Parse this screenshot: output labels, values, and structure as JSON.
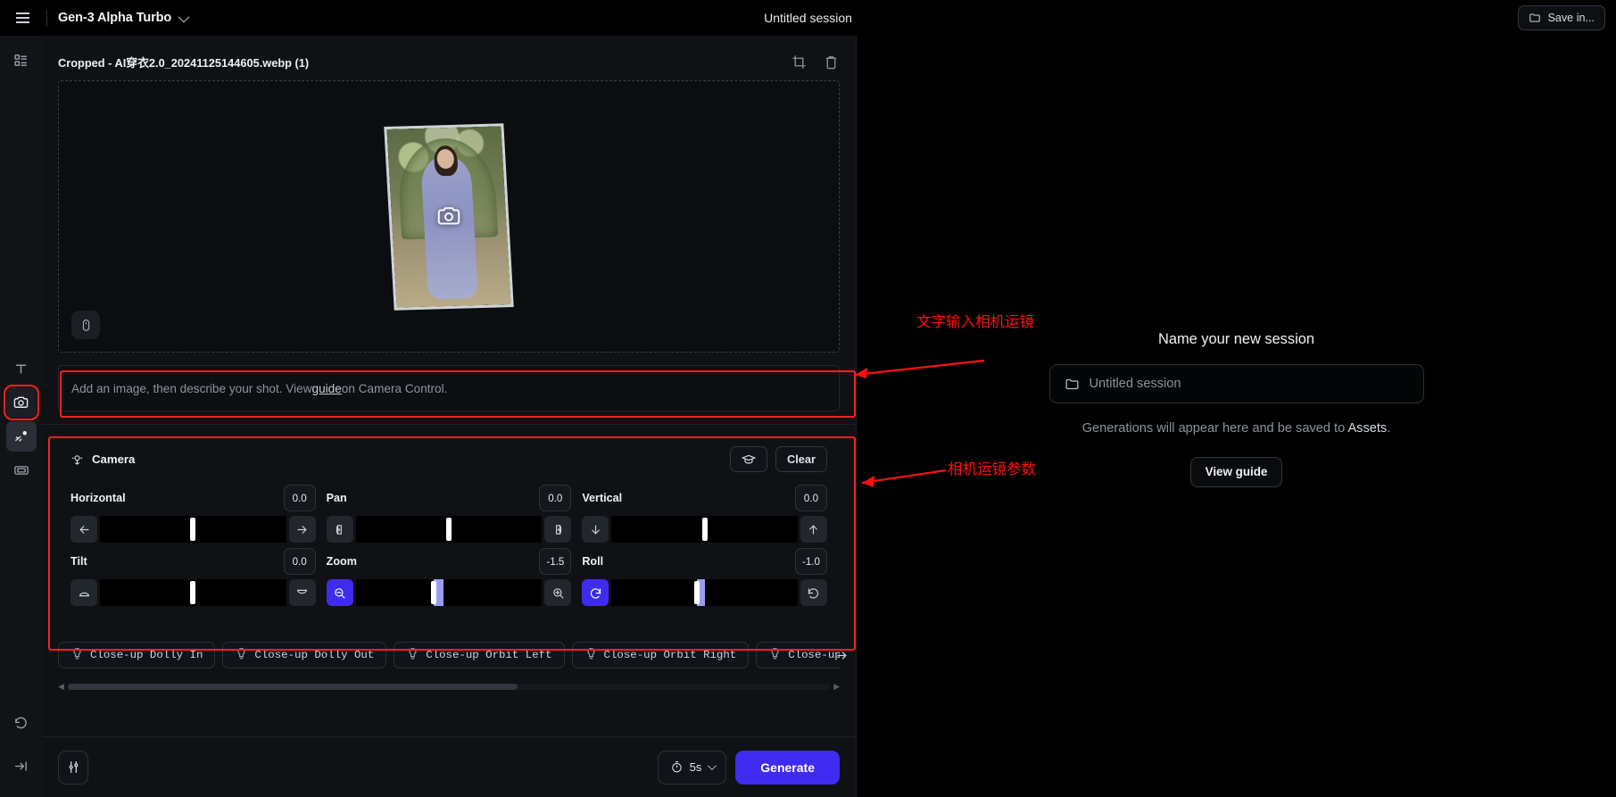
{
  "topbar": {
    "menu_icon": "hamburger-icon",
    "model": "Gen-3 Alpha Turbo",
    "session_title": "Untitled session",
    "save_in_label": "Save in...",
    "save_in_icon": "folder-icon"
  },
  "rail": {
    "items": [
      {
        "name": "assets-icon",
        "label": "Assets"
      },
      {
        "name": "text-icon",
        "label": "Text"
      },
      {
        "name": "camera-icon",
        "label": "Camera Control"
      },
      {
        "name": "motion-brush-icon",
        "label": "Motion Brush"
      },
      {
        "name": "frames-icon",
        "label": "Frames"
      },
      {
        "name": "history-icon",
        "label": "History"
      },
      {
        "name": "collapse-icon",
        "label": "Collapse"
      }
    ]
  },
  "image_panel": {
    "title": "Cropped - AI穿衣2.0_20241125144605.webp (1)",
    "crop_icon": "crop-icon",
    "delete_icon": "trash-icon",
    "overlay_icon": "camera-icon",
    "mouse_chip_icon": "mouse-icon"
  },
  "prompt": {
    "text_before": "Add an image, then describe your shot. View ",
    "link": "guide",
    "text_after": " on Camera Control."
  },
  "camera_panel": {
    "title": "Camera",
    "title_icon": "camera-move-icon",
    "guide_btn_icon": "graduation-cap-icon",
    "clear_label": "Clear",
    "controls": [
      {
        "label": "Horizontal",
        "value": "0.0",
        "left_icon": "arrow-left-icon",
        "right_icon": "arrow-right-icon",
        "thumb_pct": 50,
        "fill_pct": 0,
        "left_active": false,
        "right_active": false
      },
      {
        "label": "Pan",
        "value": "0.0",
        "left_icon": "pan-left-icon",
        "right_icon": "pan-right-icon",
        "thumb_pct": 50,
        "fill_pct": 0,
        "left_active": false,
        "right_active": false
      },
      {
        "label": "Vertical",
        "value": "0.0",
        "left_icon": "arrow-down-icon",
        "right_icon": "arrow-up-icon",
        "thumb_pct": 50,
        "fill_pct": 0,
        "left_active": false,
        "right_active": false
      },
      {
        "label": "Tilt",
        "value": "0.0",
        "left_icon": "tilt-up-icon",
        "right_icon": "tilt-down-icon",
        "thumb_pct": 50,
        "fill_pct": 0,
        "left_active": false,
        "right_active": false
      },
      {
        "label": "Zoom",
        "value": "-1.5",
        "left_icon": "zoom-out-icon",
        "right_icon": "zoom-in-icon",
        "thumb_pct": 42,
        "fill_pct": 5,
        "left_active": true,
        "right_active": false
      },
      {
        "label": "Roll",
        "value": "-1.0",
        "left_icon": "rotate-ccw-icon",
        "right_icon": "rotate-cw-icon",
        "thumb_pct": 46,
        "fill_pct": 4,
        "left_active": true,
        "right_active": false
      }
    ]
  },
  "presets": {
    "icon": "lightbulb-icon",
    "next_icon": "arrow-right-icon",
    "items": [
      "Close-up Dolly In",
      "Close-up Dolly Out",
      "Close-up Orbit Left",
      "Close-up Orbit Right",
      "Close-up Crane Up"
    ]
  },
  "bottombar": {
    "settings_icon": "sliders-icon",
    "duration_icon": "timer-icon",
    "duration": "5s",
    "generate_label": "Generate"
  },
  "right_panel": {
    "title": "Name your new session",
    "input_icon": "folder-icon",
    "input_placeholder": "Untitled session",
    "subtitle_a": "Generations will appear here and be saved to ",
    "subtitle_b": "Assets",
    "subtitle_c": ".",
    "view_guide_label": "View guide"
  },
  "annotations": {
    "accent_color": "#ff1010",
    "note_prompt": "文字输入相机运镜",
    "note_camera": "相机运镜参数"
  }
}
